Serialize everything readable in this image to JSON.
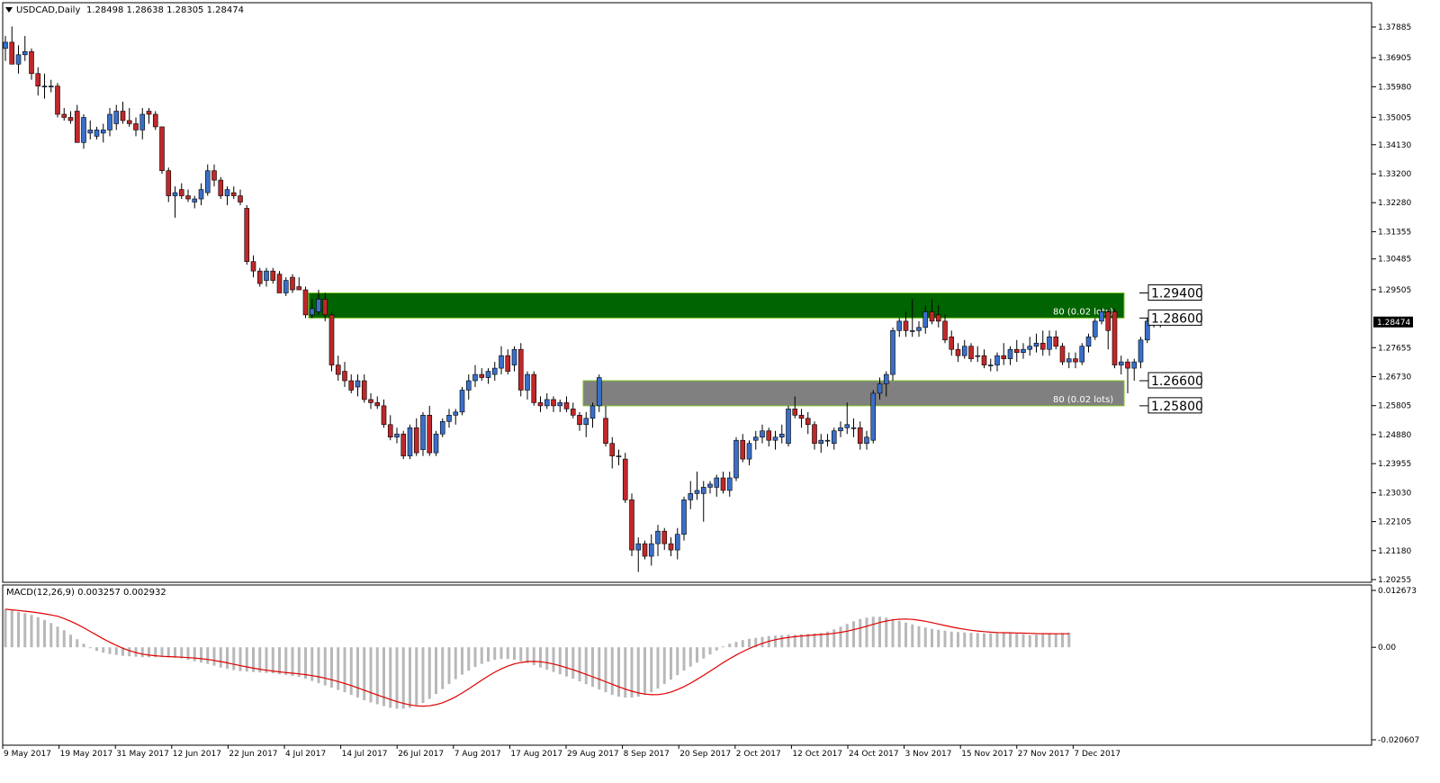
{
  "header": {
    "symbol_label": "USDCAD,Daily",
    "ohlc": "1.28498 1.28638 1.28305 1.28474"
  },
  "macd_label": "MACD(12,26,9) 0.003257 0.002932",
  "price_ticks": [
    "1.37885",
    "1.36905",
    "1.35980",
    "1.35005",
    "1.34130",
    "1.33200",
    "1.32280",
    "1.31355",
    "1.30485",
    "1.29505",
    "1.27655",
    "1.26730",
    "1.25805",
    "1.24880",
    "1.23955",
    "1.23030",
    "1.22105",
    "1.21180",
    "1.20255"
  ],
  "current_price_label": "1.28474",
  "macd_ticks": [
    "0.012673",
    "0.00",
    "-0.020607"
  ],
  "date_ticks": [
    "9 May 2017",
    "19 May 2017",
    "31 May 2017",
    "12 Jun 2017",
    "22 Jun 2017",
    "4 Jul 2017",
    "14 Jul 2017",
    "26 Jul 2017",
    "7 Aug 2017",
    "17 Aug 2017",
    "29 Aug 2017",
    "8 Sep 2017",
    "20 Sep 2017",
    "2 Oct 2017",
    "12 Oct 2017",
    "24 Oct 2017",
    "3 Nov 2017",
    "15 Nov 2017",
    "27 Nov 2017",
    "7 Dec 2017"
  ],
  "zones": [
    {
      "name": "resistance-zone",
      "top": 1.294,
      "bottom": 1.286,
      "color": "#006400",
      "order_label": "80 (0.02 lots)"
    },
    {
      "name": "support-zone",
      "top": 1.266,
      "bottom": 1.258,
      "color": "#808080",
      "order_label": "80 (0.02 lots)"
    }
  ],
  "level_labels": [
    "1.29400",
    "1.28600",
    "1.26600",
    "1.25800"
  ],
  "colors": {
    "bull": "#3a6fc8",
    "bear": "#c0282a",
    "macd_hist": "#b8b8b8",
    "signal": "#e00000"
  },
  "chart_data": {
    "type": "candlestick",
    "title": "USDCAD,Daily",
    "xlabel": "",
    "ylabel": "",
    "ylim": [
      1.201,
      1.3839
    ],
    "ohlc": [
      [
        1.372,
        1.376,
        1.368,
        1.374
      ],
      [
        1.374,
        1.379,
        1.368,
        1.367
      ],
      [
        1.367,
        1.373,
        1.364,
        1.37
      ],
      [
        1.37,
        1.376,
        1.368,
        1.371
      ],
      [
        1.371,
        1.372,
        1.362,
        1.364
      ],
      [
        1.364,
        1.366,
        1.357,
        1.36
      ],
      [
        1.36,
        1.364,
        1.356,
        1.36
      ],
      [
        1.36,
        1.362,
        1.358,
        1.36
      ],
      [
        1.36,
        1.361,
        1.35,
        1.351
      ],
      [
        1.351,
        1.353,
        1.349,
        1.35
      ],
      [
        1.35,
        1.352,
        1.348,
        1.349
      ],
      [
        1.352,
        1.354,
        1.347,
        1.342
      ],
      [
        1.342,
        1.351,
        1.34,
        1.35
      ],
      [
        1.345,
        1.349,
        1.343,
        1.346
      ],
      [
        1.344,
        1.347,
        1.343,
        1.346
      ],
      [
        1.345,
        1.348,
        1.342,
        1.346
      ],
      [
        1.346,
        1.353,
        1.344,
        1.351
      ],
      [
        1.348,
        1.354,
        1.346,
        1.352
      ],
      [
        1.352,
        1.355,
        1.348,
        1.349
      ],
      [
        1.349,
        1.353,
        1.347,
        1.348
      ],
      [
        1.348,
        1.35,
        1.344,
        1.346
      ],
      [
        1.346,
        1.353,
        1.343,
        1.351
      ],
      [
        1.352,
        1.353,
        1.348,
        1.351
      ],
      [
        1.351,
        1.352,
        1.346,
        1.347
      ],
      [
        1.347,
        1.347,
        1.332,
        1.333
      ],
      [
        1.333,
        1.334,
        1.323,
        1.325
      ],
      [
        1.325,
        1.328,
        1.318,
        1.326
      ],
      [
        1.327,
        1.329,
        1.324,
        1.325
      ],
      [
        1.325,
        1.327,
        1.323,
        1.324
      ],
      [
        1.323,
        1.325,
        1.321,
        1.324
      ],
      [
        1.324,
        1.329,
        1.322,
        1.327
      ],
      [
        1.326,
        1.335,
        1.325,
        1.333
      ],
      [
        1.333,
        1.335,
        1.328,
        1.33
      ],
      [
        1.33,
        1.331,
        1.324,
        1.325
      ],
      [
        1.325,
        1.328,
        1.322,
        1.327
      ],
      [
        1.326,
        1.328,
        1.324,
        1.325
      ],
      [
        1.325,
        1.327,
        1.322,
        1.323
      ],
      [
        1.321,
        1.322,
        1.303,
        1.304
      ],
      [
        1.304,
        1.306,
        1.299,
        1.301
      ],
      [
        1.301,
        1.302,
        1.296,
        1.297
      ],
      [
        1.298,
        1.302,
        1.296,
        1.301
      ],
      [
        1.301,
        1.302,
        1.297,
        1.298
      ],
      [
        1.3,
        1.301,
        1.294,
        1.294
      ],
      [
        1.294,
        1.299,
        1.293,
        1.298
      ],
      [
        1.299,
        1.3,
        1.294,
        1.295
      ],
      [
        1.296,
        1.299,
        1.295,
        1.295
      ],
      [
        1.295,
        1.296,
        1.286,
        1.287
      ],
      [
        1.287,
        1.292,
        1.286,
        1.289
      ],
      [
        1.288,
        1.295,
        1.287,
        1.292
      ],
      [
        1.292,
        1.294,
        1.285,
        1.287
      ],
      [
        1.287,
        1.288,
        1.269,
        1.271
      ],
      [
        1.271,
        1.274,
        1.266,
        1.268
      ],
      [
        1.269,
        1.272,
        1.264,
        1.266
      ],
      [
        1.266,
        1.268,
        1.262,
        1.263
      ],
      [
        1.264,
        1.268,
        1.261,
        1.266
      ],
      [
        1.266,
        1.268,
        1.259,
        1.26
      ],
      [
        1.26,
        1.262,
        1.257,
        1.259
      ],
      [
        1.259,
        1.261,
        1.257,
        1.258
      ],
      [
        1.258,
        1.26,
        1.251,
        1.252
      ],
      [
        1.252,
        1.255,
        1.247,
        1.248
      ],
      [
        1.248,
        1.251,
        1.246,
        1.249
      ],
      [
        1.249,
        1.25,
        1.241,
        1.242
      ],
      [
        1.242,
        1.252,
        1.241,
        1.251
      ],
      [
        1.251,
        1.254,
        1.242,
        1.243
      ],
      [
        1.244,
        1.256,
        1.242,
        1.255
      ],
      [
        1.255,
        1.258,
        1.242,
        1.243
      ],
      [
        1.243,
        1.25,
        1.242,
        1.249
      ],
      [
        1.249,
        1.254,
        1.248,
        1.253
      ],
      [
        1.253,
        1.257,
        1.251,
        1.255
      ],
      [
        1.255,
        1.257,
        1.252,
        1.256
      ],
      [
        1.256,
        1.264,
        1.255,
        1.263
      ],
      [
        1.263,
        1.268,
        1.26,
        1.266
      ],
      [
        1.266,
        1.271,
        1.264,
        1.268
      ],
      [
        1.268,
        1.27,
        1.266,
        1.267
      ],
      [
        1.267,
        1.27,
        1.265,
        1.269
      ],
      [
        1.268,
        1.272,
        1.266,
        1.27
      ],
      [
        1.27,
        1.277,
        1.268,
        1.274
      ],
      [
        1.274,
        1.276,
        1.268,
        1.269
      ],
      [
        1.271,
        1.277,
        1.269,
        1.276
      ],
      [
        1.276,
        1.278,
        1.261,
        1.263
      ],
      [
        1.263,
        1.269,
        1.26,
        1.268
      ],
      [
        1.268,
        1.269,
        1.258,
        1.259
      ],
      [
        1.259,
        1.261,
        1.256,
        1.258
      ],
      [
        1.258,
        1.262,
        1.257,
        1.26
      ],
      [
        1.26,
        1.261,
        1.256,
        1.258
      ],
      [
        1.258,
        1.26,
        1.256,
        1.259
      ],
      [
        1.259,
        1.261,
        1.256,
        1.257
      ],
      [
        1.257,
        1.259,
        1.254,
        1.255
      ],
      [
        1.255,
        1.256,
        1.25,
        1.252
      ],
      [
        1.252,
        1.256,
        1.248,
        1.254
      ],
      [
        1.254,
        1.259,
        1.251,
        1.258
      ],
      [
        1.258,
        1.268,
        1.256,
        1.267
      ],
      [
        1.254,
        1.258,
        1.245,
        1.246
      ],
      [
        1.246,
        1.248,
        1.238,
        1.242
      ],
      [
        1.242,
        1.244,
        1.239,
        1.242
      ],
      [
        1.241,
        1.243,
        1.227,
        1.228
      ],
      [
        1.228,
        1.23,
        1.21,
        1.212
      ],
      [
        1.212,
        1.216,
        1.205,
        1.214
      ],
      [
        1.214,
        1.215,
        1.209,
        1.21
      ],
      [
        1.21,
        1.217,
        1.207,
        1.214
      ],
      [
        1.214,
        1.22,
        1.21,
        1.218
      ],
      [
        1.218,
        1.219,
        1.212,
        1.214
      ],
      [
        1.214,
        1.216,
        1.21,
        1.212
      ],
      [
        1.212,
        1.219,
        1.209,
        1.217
      ],
      [
        1.217,
        1.229,
        1.215,
        1.228
      ],
      [
        1.228,
        1.234,
        1.225,
        1.23
      ],
      [
        1.23,
        1.237,
        1.228,
        1.231
      ],
      [
        1.23,
        1.234,
        1.221,
        1.232
      ],
      [
        1.232,
        1.234,
        1.23,
        1.233
      ],
      [
        1.232,
        1.236,
        1.229,
        1.235
      ],
      [
        1.235,
        1.237,
        1.23,
        1.231
      ],
      [
        1.231,
        1.237,
        1.229,
        1.235
      ],
      [
        1.235,
        1.248,
        1.234,
        1.247
      ],
      [
        1.247,
        1.249,
        1.24,
        1.241
      ],
      [
        1.241,
        1.247,
        1.239,
        1.246
      ],
      [
        1.247,
        1.25,
        1.244,
        1.248
      ],
      [
        1.248,
        1.252,
        1.246,
        1.25
      ],
      [
        1.25,
        1.251,
        1.245,
        1.247
      ],
      [
        1.247,
        1.25,
        1.244,
        1.248
      ],
      [
        1.248,
        1.252,
        1.246,
        1.249
      ],
      [
        1.246,
        1.258,
        1.245,
        1.257
      ],
      [
        1.257,
        1.261,
        1.254,
        1.255
      ],
      [
        1.255,
        1.257,
        1.251,
        1.254
      ],
      [
        1.254,
        1.256,
        1.249,
        1.252
      ],
      [
        1.252,
        1.253,
        1.244,
        1.246
      ],
      [
        1.246,
        1.249,
        1.243,
        1.247
      ],
      [
        1.247,
        1.249,
        1.245,
        1.247
      ],
      [
        1.246,
        1.251,
        1.244,
        1.25
      ],
      [
        1.25,
        1.253,
        1.248,
        1.251
      ],
      [
        1.251,
        1.259,
        1.249,
        1.252
      ],
      [
        1.251,
        1.254,
        1.248,
        1.251
      ],
      [
        1.251,
        1.253,
        1.244,
        1.246
      ],
      [
        1.246,
        1.25,
        1.244,
        1.248
      ],
      [
        1.247,
        1.263,
        1.246,
        1.262
      ],
      [
        1.262,
        1.267,
        1.26,
        1.265
      ],
      [
        1.265,
        1.269,
        1.261,
        1.268
      ],
      [
        1.268,
        1.283,
        1.266,
        1.282
      ],
      [
        1.282,
        1.286,
        1.28,
        1.285
      ],
      [
        1.285,
        1.288,
        1.28,
        1.282
      ],
      [
        1.282,
        1.292,
        1.28,
        1.282
      ],
      [
        1.282,
        1.285,
        1.28,
        1.283
      ],
      [
        1.283,
        1.29,
        1.281,
        1.288
      ],
      [
        1.288,
        1.292,
        1.284,
        1.285
      ],
      [
        1.287,
        1.29,
        1.283,
        1.285
      ],
      [
        1.285,
        1.287,
        1.278,
        1.279
      ],
      [
        1.28,
        1.282,
        1.274,
        1.276
      ],
      [
        1.276,
        1.278,
        1.272,
        1.274
      ],
      [
        1.274,
        1.279,
        1.273,
        1.277
      ],
      [
        1.277,
        1.278,
        1.272,
        1.273
      ],
      [
        1.274,
        1.277,
        1.272,
        1.274
      ],
      [
        1.274,
        1.276,
        1.27,
        1.271
      ],
      [
        1.271,
        1.273,
        1.269,
        1.271
      ],
      [
        1.271,
        1.275,
        1.269,
        1.274
      ],
      [
        1.274,
        1.278,
        1.271,
        1.273
      ],
      [
        1.273,
        1.277,
        1.271,
        1.276
      ],
      [
        1.276,
        1.279,
        1.272,
        1.275
      ],
      [
        1.275,
        1.278,
        1.273,
        1.276
      ],
      [
        1.276,
        1.28,
        1.274,
        1.277
      ],
      [
        1.277,
        1.281,
        1.275,
        1.278
      ],
      [
        1.278,
        1.282,
        1.274,
        1.276
      ],
      [
        1.276,
        1.282,
        1.274,
        1.28
      ],
      [
        1.28,
        1.282,
        1.276,
        1.277
      ],
      [
        1.277,
        1.278,
        1.271,
        1.272
      ],
      [
        1.272,
        1.275,
        1.27,
        1.273
      ],
      [
        1.273,
        1.275,
        1.27,
        1.272
      ],
      [
        1.272,
        1.278,
        1.271,
        1.277
      ],
      [
        1.277,
        1.281,
        1.275,
        1.28
      ],
      [
        1.28,
        1.286,
        1.279,
        1.285
      ],
      [
        1.285,
        1.289,
        1.284,
        1.288
      ],
      [
        1.288,
        1.289,
        1.276,
        1.282
      ],
      [
        1.288,
        1.289,
        1.27,
        1.271
      ],
      [
        1.271,
        1.274,
        1.268,
        1.272
      ],
      [
        1.272,
        1.273,
        1.262,
        1.27
      ],
      [
        1.27,
        1.273,
        1.266,
        1.272
      ],
      [
        1.272,
        1.28,
        1.27,
        1.279
      ],
      [
        1.279,
        1.286,
        1.278,
        1.285
      ],
      [
        1.285,
        1.286,
        1.283,
        1.285
      ],
      [
        1.285,
        1.286,
        1.283,
        1.2847
      ]
    ],
    "macd_histogram": [
      0.0085,
      0.0082,
      0.0079,
      0.0076,
      0.0072,
      0.0067,
      0.0061,
      0.0054,
      0.0046,
      0.0038,
      0.0028,
      0.0018,
      0.0008,
      -0.0002,
      -0.0008,
      -0.0012,
      -0.0015,
      -0.0017,
      -0.0019,
      -0.002,
      -0.0021,
      -0.0022,
      -0.0022,
      -0.0022,
      -0.0022,
      -0.0022,
      -0.0023,
      -0.0025,
      -0.0028,
      -0.0031,
      -0.0034,
      -0.0037,
      -0.0041,
      -0.0045,
      -0.0048,
      -0.0051,
      -0.0053,
      -0.0054,
      -0.0055,
      -0.0056,
      -0.0057,
      -0.0058,
      -0.006,
      -0.0062,
      -0.0064,
      -0.0066,
      -0.007,
      -0.0075,
      -0.008,
      -0.0085,
      -0.009,
      -0.0095,
      -0.01,
      -0.0106,
      -0.0112,
      -0.0118,
      -0.0123,
      -0.0127,
      -0.0131,
      -0.0135,
      -0.0137,
      -0.0137,
      -0.0135,
      -0.0131,
      -0.0124,
      -0.0115,
      -0.0104,
      -0.0093,
      -0.0082,
      -0.0071,
      -0.0061,
      -0.0052,
      -0.0044,
      -0.0037,
      -0.0032,
      -0.0028,
      -0.0026,
      -0.0026,
      -0.0028,
      -0.0031,
      -0.0035,
      -0.004,
      -0.0045,
      -0.005,
      -0.0055,
      -0.006,
      -0.0065,
      -0.007,
      -0.0076,
      -0.0082,
      -0.0088,
      -0.0094,
      -0.01,
      -0.0106,
      -0.011,
      -0.0112,
      -0.0112,
      -0.011,
      -0.0106,
      -0.01,
      -0.0092,
      -0.0082,
      -0.0072,
      -0.0062,
      -0.0052,
      -0.0043,
      -0.0034,
      -0.0025,
      -0.0016,
      -0.0007,
      0.0002,
      0.0008,
      0.0012,
      0.0016,
      0.0019,
      0.0021,
      0.0023,
      0.0025,
      0.0026,
      0.0027,
      0.0028,
      0.0028,
      0.0029,
      0.003,
      0.0031,
      0.0032,
      0.0035,
      0.004,
      0.0046,
      0.0052,
      0.0058,
      0.0063,
      0.0066,
      0.0068,
      0.0068,
      0.0066,
      0.0063,
      0.0059,
      0.0055,
      0.0051,
      0.0047,
      0.0044,
      0.0041,
      0.0039,
      0.0037,
      0.0035,
      0.0034,
      0.0033,
      0.0032,
      0.0032,
      0.0031,
      0.0031,
      0.0032,
      0.0033,
      0.0033,
      0.0031,
      0.0029,
      0.0027,
      0.0028,
      0.0029,
      0.003,
      0.0031,
      0.0032,
      0.0033
    ]
  }
}
